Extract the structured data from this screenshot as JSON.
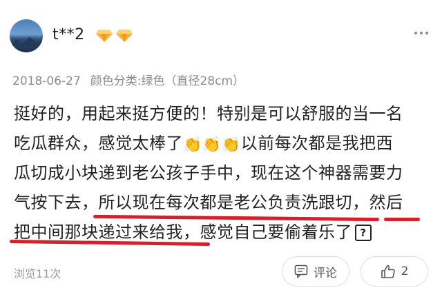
{
  "user": {
    "name": "t**2"
  },
  "meta": {
    "date": "2018-06-27",
    "variant": "颜色分类:绿色（直径28cm）"
  },
  "review": {
    "line1": "挺好的，用起来挺方便的！特别是可以舒服的当一名",
    "line2_a": "吃瓜群众，感觉太棒了",
    "line2_b": "以前每次都是我把西",
    "line3": "瓜切成小块递到老公孩子手中，现在这个神器需要力",
    "line4": "气按下去，所以现在每次都是老公负责洗跟切，然后",
    "line5": "把中间那块递过来给我，感觉自己要偷着乐了",
    "qmark": "?"
  },
  "footer": {
    "views": "浏览11次",
    "comment_label": "评论",
    "like_count": "2"
  },
  "colors": {
    "underline": "#d6202b",
    "gem": "#f6a623"
  },
  "icons": [
    "gem-icon",
    "more-icon",
    "clap-icon",
    "comment-icon",
    "thumbs-up-icon"
  ]
}
